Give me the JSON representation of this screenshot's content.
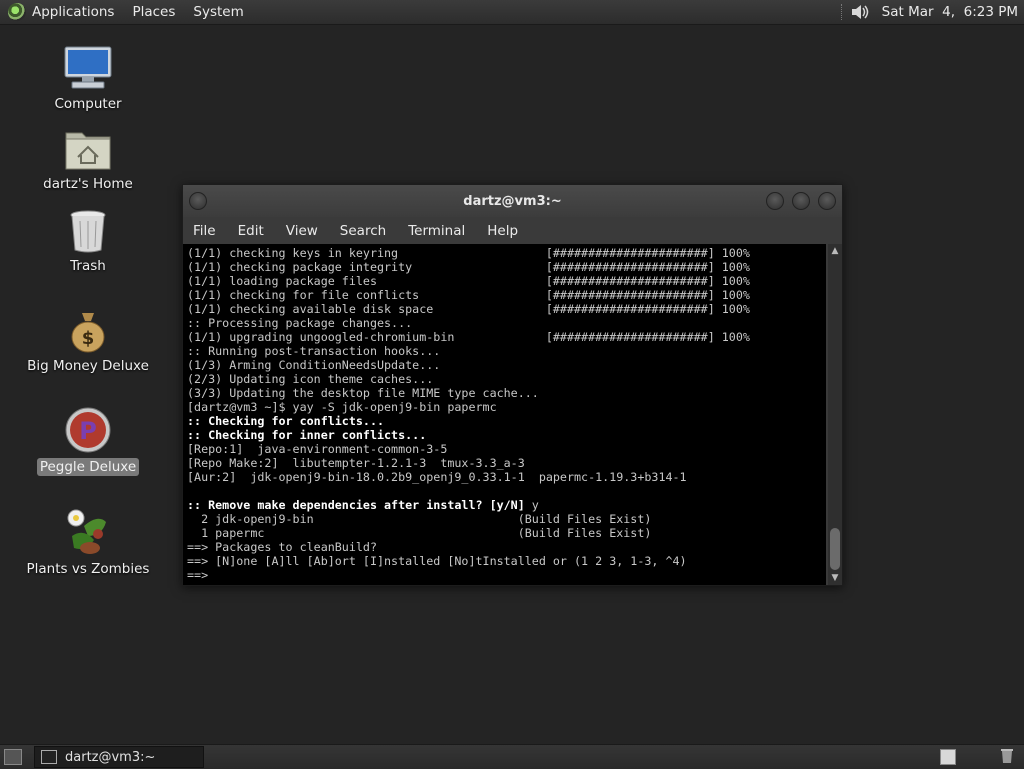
{
  "top_panel": {
    "menus": [
      "Applications",
      "Places",
      "System"
    ],
    "clock": "Sat Mar  4,  6:23 PM",
    "icons": {
      "menu_logo": "gnome-foot-icon",
      "volume": "speaker-icon"
    }
  },
  "desktop": {
    "icons": [
      {
        "label": "Computer",
        "icon": "computer-icon"
      },
      {
        "label": "dartz's Home",
        "icon": "home-folder-icon"
      },
      {
        "label": "Trash",
        "icon": "trash-icon"
      },
      {
        "label": "Big Money Deluxe",
        "icon": "money-bag-icon"
      },
      {
        "label": "Peggle Deluxe",
        "icon": "peggle-icon",
        "selected": true
      },
      {
        "label": "Plants vs Zombies",
        "icon": "plants-icon"
      }
    ]
  },
  "terminal": {
    "title": "dartz@vm3:~",
    "menu": [
      "File",
      "Edit",
      "View",
      "Search",
      "Terminal",
      "Help"
    ],
    "lines": [
      {
        "text": "(1/1) checking keys in keyring                     [######################] 100%",
        "bold": false
      },
      {
        "text": "(1/1) checking package integrity                   [######################] 100%",
        "bold": false
      },
      {
        "text": "(1/1) loading package files                        [######################] 100%",
        "bold": false
      },
      {
        "text": "(1/1) checking for file conflicts                  [######################] 100%",
        "bold": false
      },
      {
        "text": "(1/1) checking available disk space                [######################] 100%",
        "bold": false
      },
      {
        "text": ":: Processing package changes...",
        "bold": false
      },
      {
        "text": "(1/1) upgrading ungoogled-chromium-bin             [######################] 100%",
        "bold": false
      },
      {
        "text": ":: Running post-transaction hooks...",
        "bold": false
      },
      {
        "text": "(1/3) Arming ConditionNeedsUpdate...",
        "bold": false
      },
      {
        "text": "(2/3) Updating icon theme caches...",
        "bold": false
      },
      {
        "text": "(3/3) Updating the desktop file MIME type cache...",
        "bold": false
      },
      {
        "text": "[dartz@vm3 ~]$ yay -S jdk-openj9-bin papermc",
        "bold": false
      },
      {
        "text": ":: Checking for conflicts...",
        "bold": true
      },
      {
        "text": ":: Checking for inner conflicts...",
        "bold": true
      },
      {
        "text": "[Repo:1]  java-environment-common-3-5",
        "bold": false
      },
      {
        "text": "[Repo Make:2]  libutempter-1.2.1-3  tmux-3.3_a-3",
        "bold": false
      },
      {
        "text": "[Aur:2]  jdk-openj9-bin-18.0.2b9_openj9_0.33.1-1  papermc-1.19.3+b314-1",
        "bold": false
      },
      {
        "text": "",
        "bold": false
      },
      {
        "text": ":: Remove make dependencies after install? [y/N]",
        "bold": true,
        "suffix": " y"
      },
      {
        "text": "  2 jdk-openj9-bin                             (Build Files Exist)",
        "bold": false
      },
      {
        "text": "  1 papermc                                    (Build Files Exist)",
        "bold": false
      },
      {
        "text": "==> Packages to cleanBuild?",
        "bold": false
      },
      {
        "text": "==> [N]one [A]ll [Ab]ort [I]nstalled [No]tInstalled or (1 2 3, 1-3, ^4)",
        "bold": false
      },
      {
        "text": "==>",
        "bold": false
      }
    ]
  },
  "bottom_panel": {
    "task_label": "dartz@vm3:~"
  }
}
